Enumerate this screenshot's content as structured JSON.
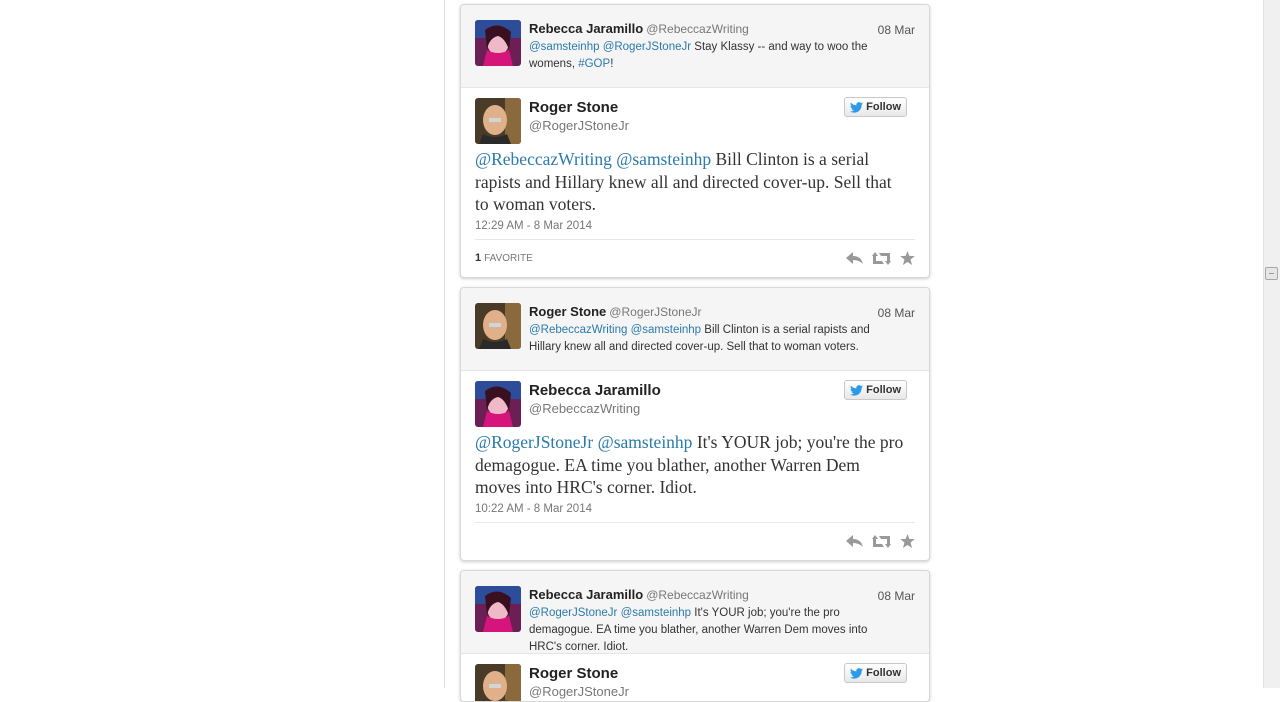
{
  "colors": {
    "link": "#2a7aab",
    "text": "#333333",
    "meta": "#777777"
  },
  "cards": [
    {
      "parent": {
        "name": "Rebecca Jaramillo",
        "handle": "@RebeccazWriting",
        "date": "08 Mar",
        "mention1": "@samsteinhp",
        "mention2": "@RogerJStoneJr",
        "text_part1": " Stay Klassy -- and way to woo the womens, ",
        "hashtag": "#GOP",
        "text_part2": "!"
      },
      "tweet": {
        "name": "Roger Stone",
        "handle": "@RogerJStoneJr",
        "follow_label": "Follow",
        "mention1": "@RebeccazWriting",
        "mention2": "@samsteinhp",
        "text": " Bill Clinton is a serial rapists and Hillary knew all and directed cover-up. Sell that to woman voters.",
        "timestamp": "12:29 AM - 8 Mar 2014",
        "favorites_count": "1",
        "favorites_label": "FAVORITE"
      }
    },
    {
      "parent": {
        "name": "Roger Stone",
        "handle": "@RogerJStoneJr",
        "date": "08 Mar",
        "mention1": "@RebeccazWriting",
        "mention2": "@samsteinhp",
        "text_part1": " Bill Clinton is a serial rapists and Hillary knew all and directed cover-up. Sell that to woman voters.",
        "hashtag": "",
        "text_part2": ""
      },
      "tweet": {
        "name": "Rebecca Jaramillo",
        "handle": "@RebeccazWriting",
        "follow_label": "Follow",
        "mention1": "@RogerJStoneJr",
        "mention2": "@samsteinhp",
        "text": " It's YOUR job; you're the pro demagogue. EA time you blather, another Warren Dem moves into HRC's corner. Idiot.",
        "timestamp": "10:22 AM - 8 Mar 2014"
      }
    },
    {
      "parent": {
        "name": "Rebecca Jaramillo",
        "handle": "@RebeccazWriting",
        "date": "08 Mar",
        "mention1": "@RogerJStoneJr",
        "mention2": "@samsteinhp",
        "text_part1": " It's YOUR job; you're the pro demagogue. EA time you blather, another Warren Dem moves into HRC's corner. Idiot.",
        "hashtag": "",
        "text_part2": ""
      },
      "tweet": {
        "name": "Roger Stone",
        "handle": "@RogerJStoneJr",
        "follow_label": "Follow"
      }
    }
  ]
}
